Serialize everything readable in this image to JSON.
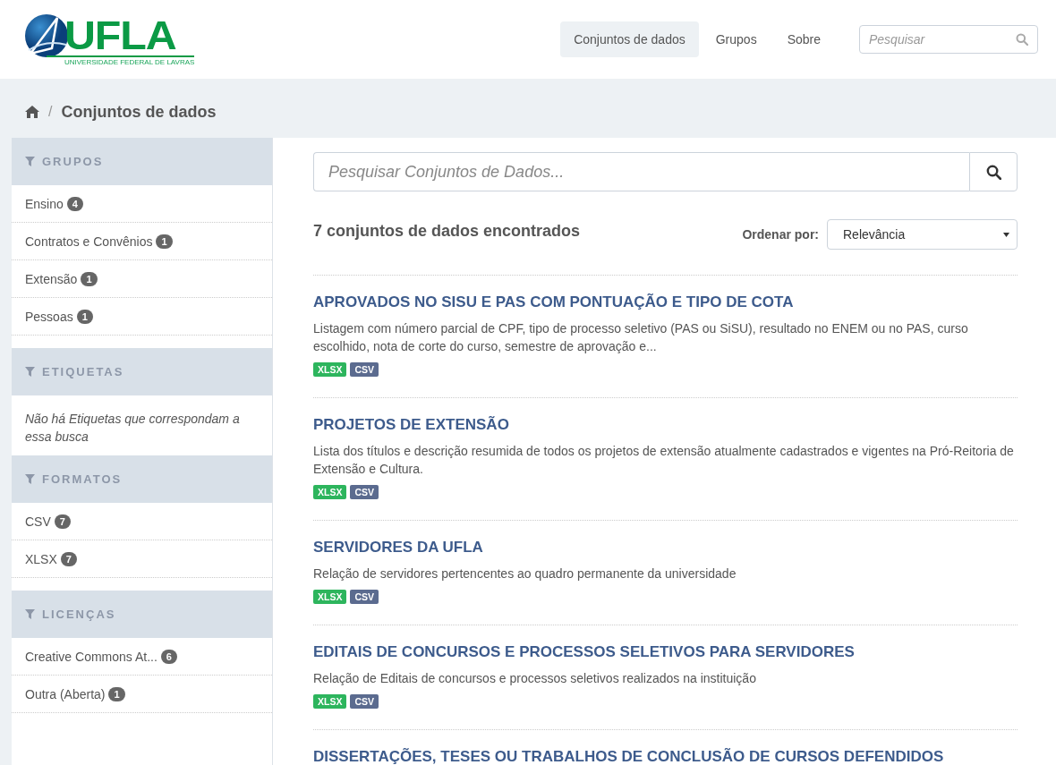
{
  "logo": {
    "mark": "UFLA",
    "subtitle": "UNIVERSIDADE FEDERAL DE LAVRAS"
  },
  "nav": [
    {
      "label": "Conjuntos de dados",
      "selected": true
    },
    {
      "label": "Grupos",
      "selected": false
    },
    {
      "label": "Sobre",
      "selected": false
    }
  ],
  "site_search": {
    "placeholder": "Pesquisar"
  },
  "breadcrumb": {
    "separator": "/",
    "current": "Conjuntos de dados"
  },
  "facets": [
    {
      "title": "GRUPOS",
      "items": [
        {
          "label": "Ensino",
          "count": "4"
        },
        {
          "label": "Contratos e Convênios",
          "count": "1"
        },
        {
          "label": "Extensão",
          "count": "1"
        },
        {
          "label": "Pessoas",
          "count": "1"
        }
      ]
    },
    {
      "title": "ETIQUETAS",
      "empty_message": "Não há Etiquetas que correspondam a essa busca"
    },
    {
      "title": "FORMATOS",
      "items": [
        {
          "label": "CSV",
          "count": "7"
        },
        {
          "label": "XLSX",
          "count": "7"
        }
      ]
    },
    {
      "title": "LICENÇAS",
      "items": [
        {
          "label": "Creative Commons At...",
          "count": "6"
        },
        {
          "label": "Outra (Aberta)",
          "count": "1"
        }
      ]
    }
  ],
  "dataset_search": {
    "placeholder": "Pesquisar Conjuntos de Dados..."
  },
  "results_count": "7 conjuntos de dados encontrados",
  "sort": {
    "label": "Ordenar por:",
    "value": "Relevância"
  },
  "datasets": [
    {
      "title": "APROVADOS NO SISU E PAS COM PONTUAÇÃO E TIPO DE COTA",
      "description": "Listagem com número parcial de CPF, tipo de processo seletivo (PAS ou SiSU), resultado no ENEM ou no PAS, curso escolhido, nota de corte do curso, semestre de aprovação e...",
      "formats": [
        {
          "label": "XLSX",
          "color": "#2db55d"
        },
        {
          "label": "CSV",
          "color": "#5b6b8f"
        }
      ]
    },
    {
      "title": "PROJETOS DE EXTENSÃO",
      "description": "Lista dos títulos e descrição resumida de todos os projetos de extensão atualmente cadastrados e vigentes na Pró-Reitoria de Extensão e Cultura.",
      "formats": [
        {
          "label": "XLSX",
          "color": "#2db55d"
        },
        {
          "label": "CSV",
          "color": "#5b6b8f"
        }
      ]
    },
    {
      "title": "SERVIDORES DA UFLA",
      "description": "Relação de servidores pertencentes ao quadro permanente da universidade",
      "formats": [
        {
          "label": "XLSX",
          "color": "#2db55d"
        },
        {
          "label": "CSV",
          "color": "#5b6b8f"
        }
      ]
    },
    {
      "title": "EDITAIS DE CONCURSOS E PROCESSOS SELETIVOS PARA SERVIDORES",
      "description": "Relação de Editais de concursos e processos seletivos realizados na instituição",
      "formats": [
        {
          "label": "XLSX",
          "color": "#2db55d"
        },
        {
          "label": "CSV",
          "color": "#5b6b8f"
        }
      ]
    },
    {
      "title": "DISSERTAÇÕES, TESES OU TRABALHOS DE CONCLUSÃO DE CURSOS DEFENDIDOS"
    }
  ]
}
